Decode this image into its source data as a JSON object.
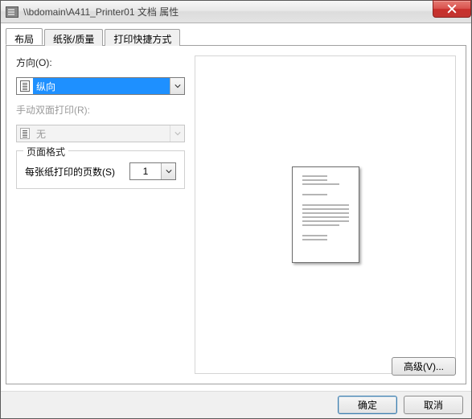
{
  "window": {
    "title": "\\\\bdomain\\A411_Printer01 文档 属性"
  },
  "tabs": {
    "layout": "布局",
    "paper": "纸张/质量",
    "shortcuts": "打印快捷方式"
  },
  "layout_tab": {
    "orientation_label": "方向(O):",
    "orientation_value": "纵向",
    "duplex_label": "手动双面打印(R):",
    "duplex_value": "无",
    "page_format_legend": "页面格式",
    "pages_per_sheet_label": "每张纸打印的页数(S)",
    "pages_per_sheet_value": "1",
    "advanced_button": "高级(V)..."
  },
  "footer": {
    "ok": "确定",
    "cancel": "取消"
  }
}
